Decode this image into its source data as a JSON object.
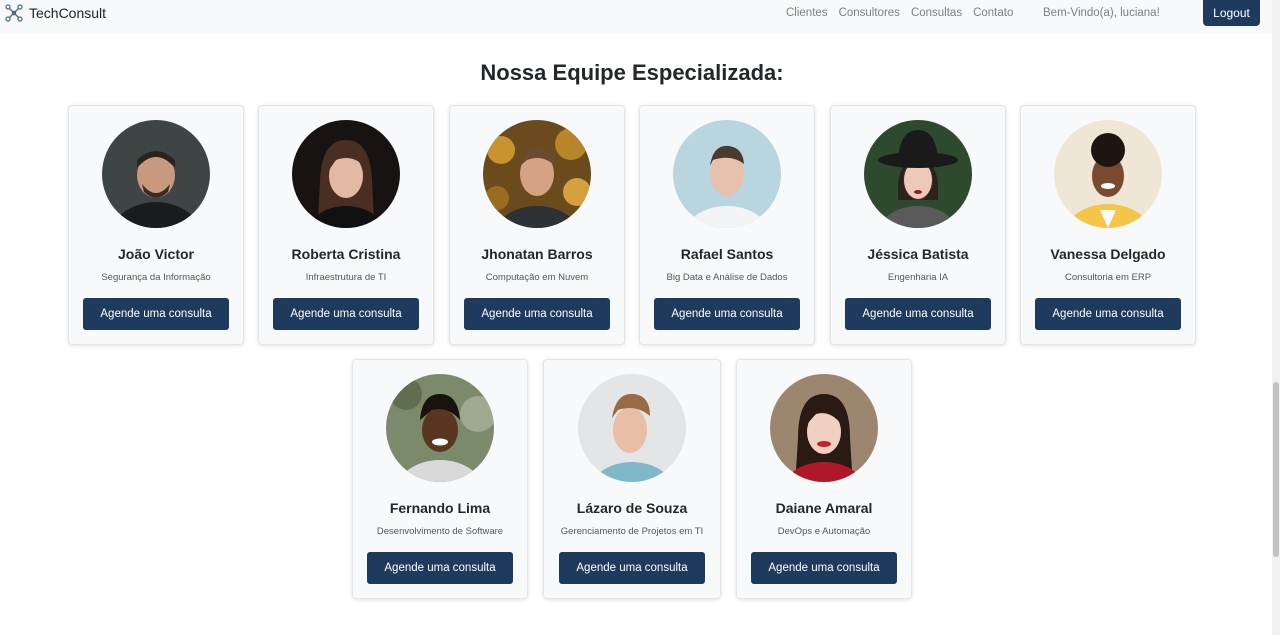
{
  "navbar": {
    "brand": "TechConsult",
    "brand_icon": "network-nodes-icon",
    "links": [
      "Clientes",
      "Consultores",
      "Consultas",
      "Contato"
    ],
    "greeting": "Bem-Vindo(a), luciana!",
    "logout_label": "Logout"
  },
  "page_title": "Nossa Equipe Especializada:",
  "consultants": [
    {
      "name": "João Victor",
      "specialty": "Segurança da Informação",
      "button": "Agende uma consulta"
    },
    {
      "name": "Roberta Cristina",
      "specialty": "Infraestrutura de TI",
      "button": "Agende uma consulta"
    },
    {
      "name": "Jhonatan Barros",
      "specialty": "Computação em Nuvem",
      "button": "Agende uma consulta"
    },
    {
      "name": "Rafael Santos",
      "specialty": "Big Data e Análise de Dados",
      "button": "Agende uma consulta"
    },
    {
      "name": "Jéssica Batista",
      "specialty": "Engenharia IA",
      "button": "Agende uma consulta"
    },
    {
      "name": "Vanessa Delgado",
      "specialty": "Consultoria em ERP",
      "button": "Agende uma consulta"
    },
    {
      "name": "Fernando Lima",
      "specialty": "Desenvolvimento de Software",
      "button": "Agende uma consulta"
    },
    {
      "name": "Lázaro de Souza",
      "specialty": "Gerenciamento de Projetos em TI",
      "button": "Agende uma consulta"
    },
    {
      "name": "Daiane Amaral",
      "specialty": "DevOps e Automação",
      "button": "Agende uma consulta"
    }
  ],
  "colors": {
    "primary": "#1e3a5c",
    "navbar_bg": "#f8f9fa",
    "card_bg": "#f8f9fa"
  }
}
